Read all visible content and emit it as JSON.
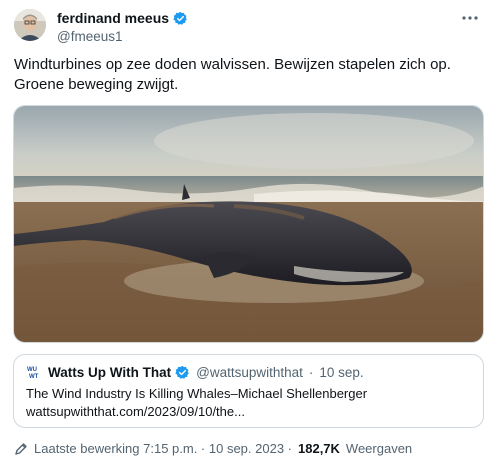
{
  "author": {
    "display_name": "ferdinand meeus",
    "handle": "@fmeeus1",
    "verified_color": "#1d9bf0"
  },
  "tweet": {
    "text_line1": "Windturbines op zee doden walvissen. Bewijzen stapelen zich op.",
    "text_line2": "Groene beweging zwijgt."
  },
  "quote": {
    "logo_text": "WU WT",
    "source_name": "Watts Up With That",
    "source_handle": "@wattsupwiththat",
    "separator": "·",
    "date": "10 sep.",
    "title": "The Wind Industry Is Killing Whales–Michael Shellenberger",
    "link": "wattsupwiththat.com/2023/09/10/the..."
  },
  "footer": {
    "edited_label": "Laatste bewerking 7:15 p.m. · 10 sep. 2023 ·",
    "views_count": "182,7K",
    "views_label": "Weergaven"
  },
  "colors": {
    "text_primary": "#0f1419",
    "text_secondary": "#536471",
    "border": "#cfd9de",
    "accent": "#1d9bf0"
  }
}
